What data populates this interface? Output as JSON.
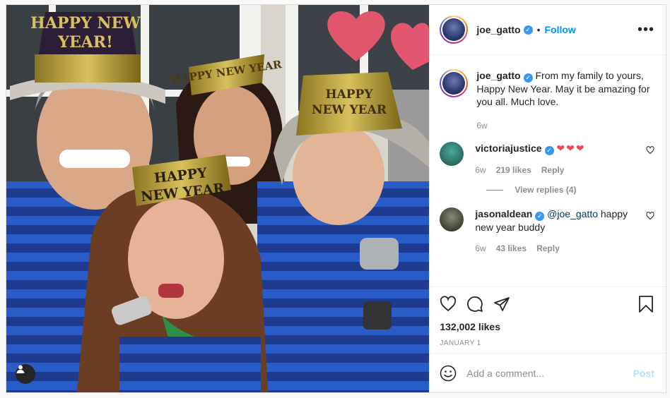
{
  "post": {
    "author": "joe_gatto",
    "follow_label": "Follow",
    "dot": "•",
    "more_label": "•••",
    "verified_mark": "✓",
    "caption": {
      "user": "joe_gatto",
      "text": "From my family to yours, Happy New Year. May it be amazing for you all. Much love.",
      "age": "6w"
    },
    "photo": {
      "hat_text_left": "HAPPY NEW YEAR!",
      "hat_text_mom": "HAPPY NEW YEAR",
      "hat_text_girl": "HAPPY NEW YEAR",
      "hat_text_boy": "HAPPY NEW YEAR"
    }
  },
  "comments": [
    {
      "user": "victoriajustice",
      "text": "❤❤❤",
      "age": "6w",
      "likes": "219 likes",
      "reply": "Reply",
      "avatar_color": "#2f7a6a"
    },
    {
      "user": "jasonaldean",
      "mention": "@joe_gatto",
      "text": " happy new year buddy",
      "age": "6w",
      "likes": "43 likes",
      "reply": "Reply",
      "avatar_color": "#3a3a2e"
    }
  ],
  "view_replies": "View replies (4)",
  "stats": {
    "likes": "132,002 likes",
    "date": "JANUARY 1"
  },
  "add_comment": {
    "placeholder": "Add a comment...",
    "post_label": "Post"
  },
  "colors": {
    "accent": "#0095f6",
    "post_disabled": "#b2dffc",
    "heart": "#ed4956"
  },
  "icons": [
    "heart-icon",
    "comment-icon",
    "share-icon",
    "bookmark-icon",
    "emoji-icon",
    "user-tag-icon",
    "more-icon"
  ]
}
